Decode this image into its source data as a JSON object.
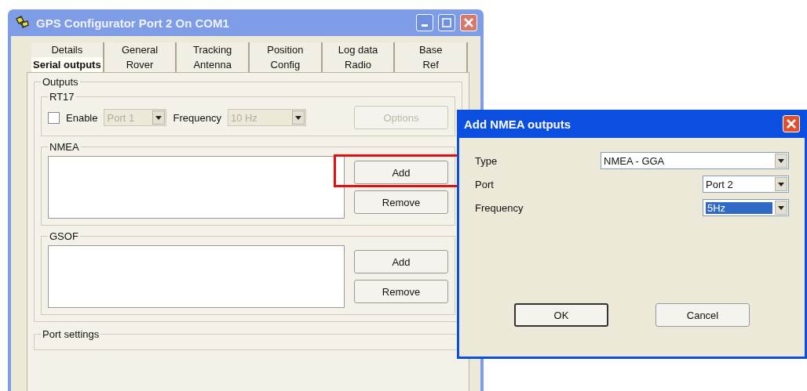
{
  "main_window": {
    "title": "GPS Configurator Port 2 On COM1",
    "tab_rows": [
      [
        {
          "label": "Details",
          "selected": false
        },
        {
          "label": "General",
          "selected": false
        },
        {
          "label": "Tracking",
          "selected": false
        },
        {
          "label": "Position",
          "selected": false
        },
        {
          "label": "Log data",
          "selected": false
        },
        {
          "label": "Base",
          "selected": false
        }
      ],
      [
        {
          "label": "Serial outputs",
          "selected": true
        },
        {
          "label": "Rover",
          "selected": false
        },
        {
          "label": "Antenna",
          "selected": false
        },
        {
          "label": "Config",
          "selected": false
        },
        {
          "label": "Radio",
          "selected": false
        },
        {
          "label": "Ref",
          "selected": false
        }
      ]
    ],
    "outputs": {
      "label": "Outputs",
      "rt17": {
        "label": "RT17",
        "enable": {
          "label": "Enable",
          "checked": false
        },
        "port": {
          "value": "Port 1",
          "disabled": true
        },
        "frequency_label": "Frequency",
        "frequency": {
          "value": "10 Hz",
          "disabled": true
        },
        "options_button": {
          "label": "Options",
          "disabled": true
        }
      },
      "lists": [
        {
          "label": "NMEA",
          "buttons": [
            {
              "label": "Add",
              "highlighted": true
            },
            {
              "label": "Remove",
              "highlighted": false
            }
          ]
        },
        {
          "label": "GSOF",
          "buttons": [
            {
              "label": "Add",
              "highlighted": false
            },
            {
              "label": "Remove",
              "highlighted": false
            }
          ]
        }
      ]
    },
    "port_settings": {
      "label": "Port settings"
    }
  },
  "dialog": {
    "title": "Add NMEA outputs",
    "fields": [
      {
        "label": "Type",
        "value": "NMEA - GGA",
        "kind": "wide",
        "selected": false
      },
      {
        "label": "Port",
        "value": "Port 2",
        "kind": "narrow",
        "selected": false
      },
      {
        "label": "Frequency",
        "value": "5Hz",
        "kind": "narrow",
        "selected": true
      }
    ],
    "buttons": [
      {
        "label": "OK",
        "default": true
      },
      {
        "label": "Cancel",
        "default": false
      }
    ]
  }
}
